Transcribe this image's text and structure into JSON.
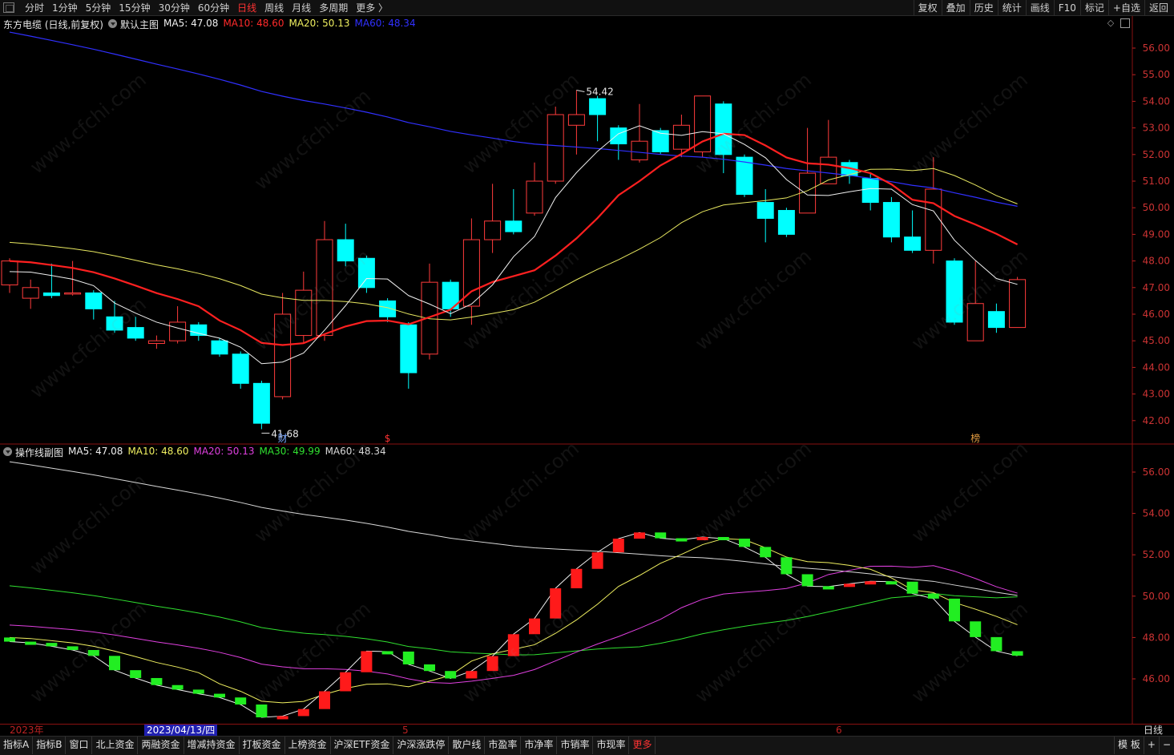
{
  "topbar": {
    "period_tabs": [
      "分时",
      "1分钟",
      "5分钟",
      "15分钟",
      "30分钟",
      "60分钟",
      "日线",
      "周线",
      "月线",
      "多周期",
      "更多 〉"
    ],
    "active_tab": "日线",
    "tools": [
      "复权",
      "叠加",
      "历史",
      "统计",
      "画线",
      "F10",
      "标记",
      "+自选",
      "返回"
    ]
  },
  "main_chart": {
    "stock_title": "东方电缆 (日线,前复权)",
    "template_label": "默认主图",
    "legend": [
      {
        "label": "MA5: 47.08",
        "color": "#f0f0f0"
      },
      {
        "label": "MA10: 48.60",
        "color": "#ff2a2a"
      },
      {
        "label": "MA20: 50.13",
        "color": "#f0f060"
      },
      {
        "label": "MA60: 48.34",
        "color": "#3030ff"
      }
    ],
    "y_ticks": [
      "56.00",
      "55.00",
      "54.00",
      "53.00",
      "52.00",
      "51.00",
      "50.00",
      "49.00",
      "48.00",
      "47.00",
      "46.00",
      "45.00",
      "44.00",
      "43.00",
      "42.00"
    ],
    "high_label": "54.42",
    "low_label": "41.68",
    "markers": [
      "财",
      "$",
      "榜"
    ]
  },
  "sub_chart": {
    "title": "操作线副图",
    "legend": [
      {
        "label": "MA5: 47.08",
        "color": "#f0f0f0"
      },
      {
        "label": "MA10: 48.60",
        "color": "#f0f060"
      },
      {
        "label": "MA20: 50.13",
        "color": "#e040e0"
      },
      {
        "label": "MA30: 49.99",
        "color": "#30e030"
      },
      {
        "label": "MA60: 48.34",
        "color": "#d8d8d8"
      }
    ],
    "y_ticks": [
      "56.00",
      "54.00",
      "52.00",
      "50.00",
      "48.00",
      "46.00"
    ]
  },
  "timebar": {
    "year_label": "2023年",
    "cursor_date": "2023/04/13/四",
    "month5": "5",
    "month6": "6",
    "period": "日线"
  },
  "bottombar": {
    "tabs": [
      "指标A",
      "指标B",
      "窗口",
      "北上资金",
      "两融资金",
      "增减持资金",
      "打板资金",
      "上榜资金",
      "沪深ETF资金",
      "沪深涨跌停",
      "散户线",
      "市盈率",
      "市净率",
      "市销率",
      "市现率",
      "更多"
    ],
    "right": [
      "模 板",
      "+",
      "−"
    ]
  },
  "watermark": "www.cfchi.com",
  "chart_data": {
    "type": "candlestick",
    "candles": [
      {
        "o": 47.1,
        "c": 48.0,
        "h": 48.1,
        "l": 46.8
      },
      {
        "o": 46.6,
        "c": 47.0,
        "h": 47.3,
        "l": 46.2
      },
      {
        "o": 46.8,
        "c": 46.7,
        "h": 47.9,
        "l": 46.6
      },
      {
        "o": 46.8,
        "c": 46.8,
        "h": 48.0,
        "l": 46.7
      },
      {
        "o": 46.8,
        "c": 46.2,
        "h": 46.9,
        "l": 45.8
      },
      {
        "o": 45.9,
        "c": 45.4,
        "h": 46.5,
        "l": 45.3
      },
      {
        "o": 45.5,
        "c": 45.1,
        "h": 45.9,
        "l": 45.0
      },
      {
        "o": 44.9,
        "c": 45.0,
        "h": 45.2,
        "l": 44.7
      },
      {
        "o": 45.0,
        "c": 45.7,
        "h": 46.3,
        "l": 44.9
      },
      {
        "o": 45.6,
        "c": 45.2,
        "h": 45.7,
        "l": 45.0
      },
      {
        "o": 45.0,
        "c": 44.5,
        "h": 45.1,
        "l": 44.4
      },
      {
        "o": 44.5,
        "c": 43.4,
        "h": 44.6,
        "l": 43.2
      },
      {
        "o": 43.4,
        "c": 41.9,
        "h": 43.5,
        "l": 41.68
      },
      {
        "o": 42.9,
        "c": 46.0,
        "h": 46.8,
        "l": 42.8
      },
      {
        "o": 45.2,
        "c": 46.9,
        "h": 47.6,
        "l": 44.9
      },
      {
        "o": 45.2,
        "c": 48.8,
        "h": 49.5,
        "l": 45.0
      },
      {
        "o": 48.8,
        "c": 48.0,
        "h": 49.4,
        "l": 47.8
      },
      {
        "o": 48.1,
        "c": 47.0,
        "h": 48.2,
        "l": 46.8
      },
      {
        "o": 46.5,
        "c": 45.9,
        "h": 46.6,
        "l": 45.7
      },
      {
        "o": 45.6,
        "c": 43.8,
        "h": 45.7,
        "l": 43.2
      },
      {
        "o": 44.5,
        "c": 47.2,
        "h": 47.9,
        "l": 44.3
      },
      {
        "o": 47.2,
        "c": 46.2,
        "h": 47.3,
        "l": 45.9
      },
      {
        "o": 46.3,
        "c": 48.8,
        "h": 49.6,
        "l": 45.6
      },
      {
        "o": 48.8,
        "c": 49.5,
        "h": 50.9,
        "l": 48.3
      },
      {
        "o": 49.5,
        "c": 49.1,
        "h": 50.7,
        "l": 49.0
      },
      {
        "o": 49.8,
        "c": 51.0,
        "h": 51.7,
        "l": 49.7
      },
      {
        "o": 51.0,
        "c": 53.5,
        "h": 53.8,
        "l": 50.9
      },
      {
        "o": 53.1,
        "c": 53.5,
        "h": 54.42,
        "l": 52.0
      },
      {
        "o": 54.1,
        "c": 53.5,
        "h": 54.2,
        "l": 52.5
      },
      {
        "o": 53.0,
        "c": 52.4,
        "h": 53.1,
        "l": 51.8
      },
      {
        "o": 51.8,
        "c": 52.5,
        "h": 53.9,
        "l": 51.7
      },
      {
        "o": 52.9,
        "c": 52.1,
        "h": 53.0,
        "l": 52.0
      },
      {
        "o": 52.2,
        "c": 53.1,
        "h": 53.5,
        "l": 51.9
      },
      {
        "o": 52.1,
        "c": 54.2,
        "h": 54.2,
        "l": 51.9
      },
      {
        "o": 53.9,
        "c": 52.0,
        "h": 54.0,
        "l": 51.3
      },
      {
        "o": 51.9,
        "c": 50.5,
        "h": 52.0,
        "l": 50.4
      },
      {
        "o": 50.2,
        "c": 49.6,
        "h": 50.7,
        "l": 48.7
      },
      {
        "o": 49.9,
        "c": 49.0,
        "h": 50.0,
        "l": 48.9
      },
      {
        "o": 49.8,
        "c": 51.3,
        "h": 53.0,
        "l": 49.8
      },
      {
        "o": 50.9,
        "c": 51.9,
        "h": 53.3,
        "l": 50.9
      },
      {
        "o": 51.7,
        "c": 51.2,
        "h": 51.8,
        "l": 50.9
      },
      {
        "o": 51.1,
        "c": 50.2,
        "h": 51.3,
        "l": 49.9
      },
      {
        "o": 50.2,
        "c": 48.9,
        "h": 50.4,
        "l": 48.7
      },
      {
        "o": 48.9,
        "c": 48.4,
        "h": 49.9,
        "l": 48.3
      },
      {
        "o": 48.4,
        "c": 50.7,
        "h": 51.9,
        "l": 47.9
      },
      {
        "o": 48.0,
        "c": 45.7,
        "h": 48.1,
        "l": 45.6
      },
      {
        "o": 45.0,
        "c": 46.4,
        "h": 48.0,
        "l": 45.0
      },
      {
        "o": 46.1,
        "c": 45.5,
        "h": 46.4,
        "l": 45.3
      },
      {
        "o": 45.5,
        "c": 47.3,
        "h": 47.4,
        "l": 45.5
      }
    ]
  }
}
